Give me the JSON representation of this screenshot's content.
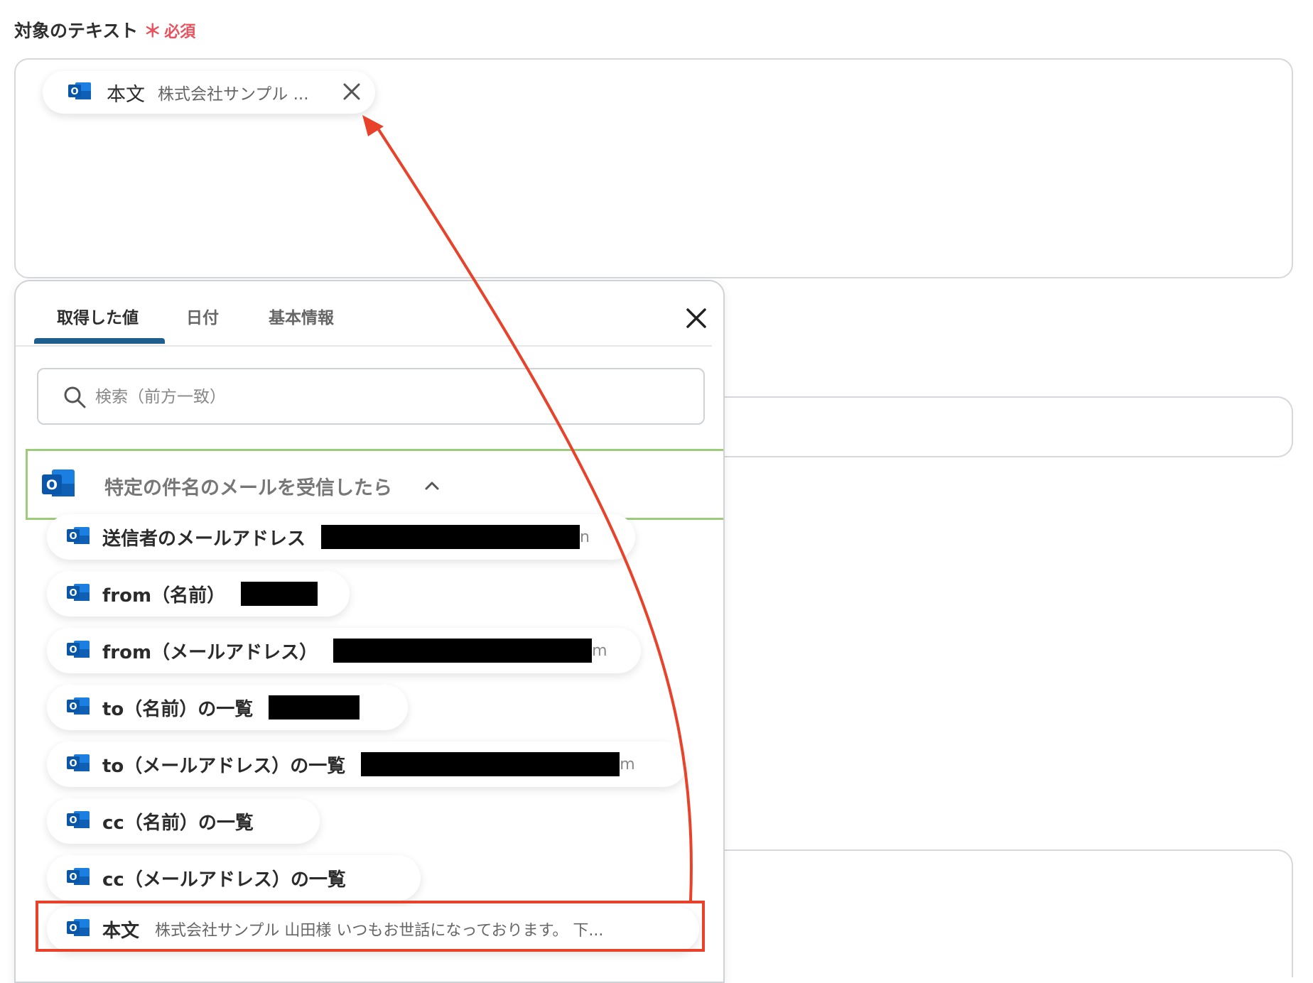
{
  "field": {
    "label": "対象のテキスト",
    "required_mark": "＊",
    "required_text": "必須"
  },
  "selected_chip": {
    "key": "本文",
    "value": "株式会社サンプル ..."
  },
  "panel": {
    "tabs": [
      "取得した値",
      "日付",
      "基本情報"
    ],
    "active_tab": 0,
    "search_placeholder": "検索（前方一致）",
    "group": {
      "title": "特定の件名のメールを受信したら",
      "expanded": true
    },
    "items": [
      {
        "label": "送信者のメールアドレス",
        "value": "",
        "tail": "n"
      },
      {
        "label": "from（名前）",
        "value": "",
        "tail": ""
      },
      {
        "label": "from（メールアドレス）",
        "value": "",
        "tail": "m"
      },
      {
        "label": "to（名前）の一覧",
        "value": "",
        "tail": ""
      },
      {
        "label": "to（メールアドレス）の一覧",
        "value": "",
        "tail": "m"
      },
      {
        "label": "cc（名前）の一覧",
        "value": "",
        "tail": ""
      },
      {
        "label": "cc（メールアドレス）の一覧",
        "value": "",
        "tail": ""
      },
      {
        "label": "本文",
        "value": "株式会社サンプル 山田様 いつもお世話になっております。 下...",
        "tail": ""
      }
    ]
  },
  "colors": {
    "accent_tab": "#1f5f8f",
    "group_border": "#9ccc7a",
    "highlight": "#e8432a",
    "required": "#e8525f",
    "outlook_blue": "#0a64c8"
  },
  "icons": {
    "app": "outlook-icon",
    "search": "search-icon",
    "close": "close-icon",
    "chevron": "chevron-up-icon"
  }
}
